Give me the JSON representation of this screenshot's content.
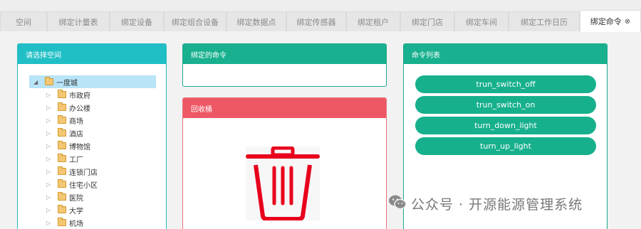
{
  "tabs": [
    {
      "label": "空间",
      "active": false
    },
    {
      "label": "绑定计量表",
      "active": false
    },
    {
      "label": "绑定设备",
      "active": false
    },
    {
      "label": "绑定组合设备",
      "active": false
    },
    {
      "label": "绑定数据点",
      "active": false
    },
    {
      "label": "绑定传感器",
      "active": false
    },
    {
      "label": "绑定租户",
      "active": false
    },
    {
      "label": "绑定门店",
      "active": false
    },
    {
      "label": "绑定车间",
      "active": false
    },
    {
      "label": "绑定工作日历",
      "active": false
    },
    {
      "label": "绑定命令",
      "active": true,
      "close_glyph": "⊗"
    }
  ],
  "space_panel": {
    "title": "请选择空间",
    "root": {
      "label": "一度城",
      "arrow": "◢"
    },
    "children": [
      "市政府",
      "办公楼",
      "商场",
      "酒店",
      "博物馆",
      "工厂",
      "连锁门店",
      "住宅小区",
      "医院",
      "大学",
      "机场"
    ],
    "collapsed_arrow": "▷"
  },
  "bound_panel": {
    "title": "绑定的命令"
  },
  "recycle_panel": {
    "title": "回收桶",
    "icon": "trash-icon"
  },
  "commands_panel": {
    "title": "命令列表",
    "commands": [
      "trun_switch_off",
      "trun_switch_on",
      "turn_down_light",
      "turn_up_light"
    ]
  },
  "watermark": {
    "text": "公众号 · 开源能源管理系统",
    "icon": "wechat-icon"
  },
  "colors": {
    "teal": "#18b08f",
    "cyan": "#20bfc6",
    "red": "#ee5865",
    "trash_red": "#e8001c",
    "tree_selected": "#b8e4f8"
  }
}
